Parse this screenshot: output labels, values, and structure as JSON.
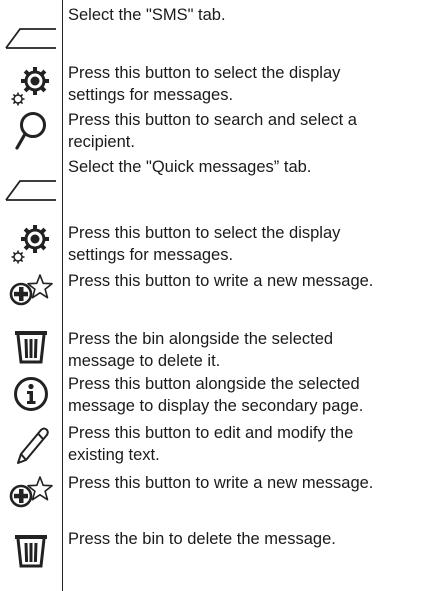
{
  "rows": [
    {
      "icon": "tab-icon",
      "lines": [
        "Select the \"SMS\" tab."
      ]
    },
    {
      "icon": "settings-gears-icon",
      "lines": [
        "Press this button to select the display",
        "settings for messages."
      ]
    },
    {
      "icon": "search-magnifier-icon",
      "lines": [
        "Press this button to search and select a",
        "recipient."
      ]
    },
    {
      "icon": "tab-icon",
      "lines": [
        "Select the \"Quick messages” tab."
      ]
    },
    {
      "icon": "settings-gears-icon",
      "lines": [
        "Press this button to select the display",
        "settings for messages."
      ]
    },
    {
      "icon": "new-message-icon",
      "lines": [
        "Press this button to write a new message."
      ]
    },
    {
      "icon": "bin-icon",
      "lines": [
        "Press the bin alongside the selected",
        "message to delete it."
      ]
    },
    {
      "icon": "info-icon",
      "lines": [
        "Press this button alongside the selected",
        "message to display the secondary page."
      ]
    },
    {
      "icon": "pencil-icon",
      "lines": [
        "Press this button to edit and modify the",
        "existing text."
      ]
    },
    {
      "icon": "new-message-icon",
      "lines": [
        "Press this button to write a new message."
      ]
    },
    {
      "icon": "bin-icon",
      "lines": [
        "Press the bin to delete the message."
      ]
    }
  ]
}
